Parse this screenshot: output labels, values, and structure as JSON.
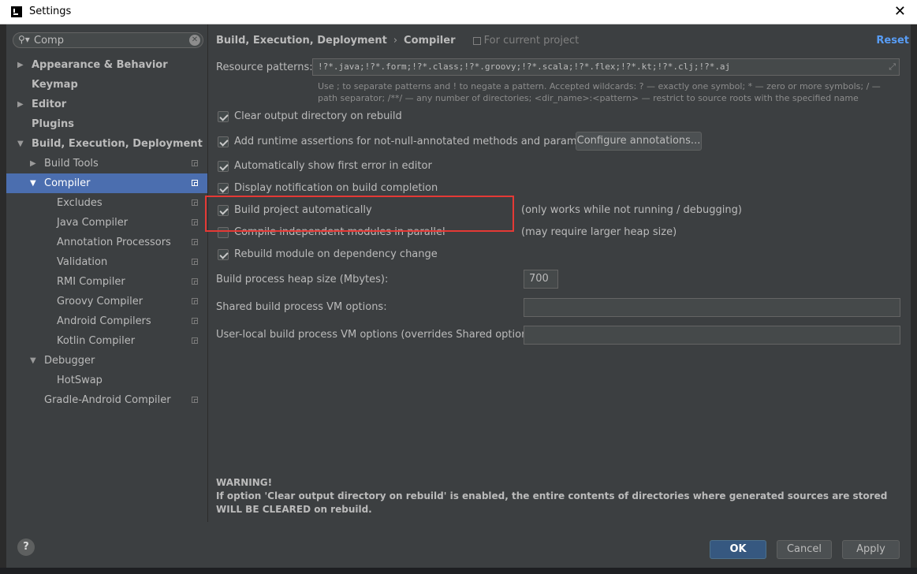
{
  "window": {
    "title": "Settings",
    "close_glyph": "✕"
  },
  "search": {
    "value": "Comp",
    "icon": "search-icon",
    "clear_glyph": "✕"
  },
  "tree": {
    "appearance": "Appearance & Behavior",
    "keymap": "Keymap",
    "editor": "Editor",
    "plugins": "Plugins",
    "build": "Build, Execution, Deployment",
    "build_tools": "Build Tools",
    "compiler": "Compiler",
    "excludes": "Excludes",
    "java_compiler": "Java Compiler",
    "annotation_processors": "Annotation Processors",
    "validation": "Validation",
    "rmi_compiler": "RMI Compiler",
    "groovy_compiler": "Groovy Compiler",
    "android_compilers": "Android Compilers",
    "kotlin_compiler": "Kotlin Compiler",
    "debugger": "Debugger",
    "hotswap": "HotSwap",
    "gradle_android": "Gradle-Android Compiler",
    "arrow_right": "▶",
    "arrow_down": "▼"
  },
  "breadcrumb": {
    "part1": "Build, Execution, Deployment",
    "sep": "›",
    "part2": "Compiler",
    "scope": "For current project"
  },
  "reset_label": "Reset",
  "resource": {
    "label": "Resource patterns:",
    "value": "!?*.java;!?*.form;!?*.class;!?*.groovy;!?*.scala;!?*.flex;!?*.kt;!?*.clj;!?*.aj",
    "expand_glyph": "⤢",
    "hint": "Use ; to separate patterns and ! to negate a pattern. Accepted wildcards: ? — exactly one symbol; * — zero or more symbols; / — path separator; /**/ — any number of directories; <dir_name>:<pattern> — restrict to source roots with the specified name"
  },
  "options": {
    "clear_output": {
      "label": "Clear output directory on rebuild",
      "checked": true
    },
    "runtime_assertions": {
      "label": "Add runtime assertions for not-null-annotated methods and parameters",
      "checked": true
    },
    "show_first_error": {
      "label": "Automatically show first error in editor",
      "checked": true
    },
    "notify_completion": {
      "label": "Display notification on build completion",
      "checked": true
    },
    "build_auto": {
      "label": "Build project automatically",
      "checked": true,
      "note": "(only works while not running / debugging)"
    },
    "parallel": {
      "label": "Compile independent modules in parallel",
      "checked": false,
      "note": "(may require larger heap size)"
    },
    "rebuild_dep": {
      "label": "Rebuild module on dependency change",
      "checked": true
    }
  },
  "configure_annotations_label": "Configure annotations...",
  "heap": {
    "label": "Build process heap size (Mbytes):",
    "value": "700"
  },
  "shared_vm": {
    "label": "Shared build process VM options:",
    "value": ""
  },
  "user_vm": {
    "label": "User-local build process VM options (overrides Shared options):",
    "value": ""
  },
  "warning": {
    "title": "WARNING!",
    "text": "If option 'Clear output directory on rebuild' is enabled, the entire contents of directories where generated sources are stored WILL BE CLEARED on rebuild."
  },
  "buttons": {
    "ok": "OK",
    "cancel": "Cancel",
    "apply": "Apply",
    "help": "?"
  },
  "colors": {
    "accent": "#4b6eaf",
    "highlight_box": "#e53935",
    "link": "#589df6"
  }
}
